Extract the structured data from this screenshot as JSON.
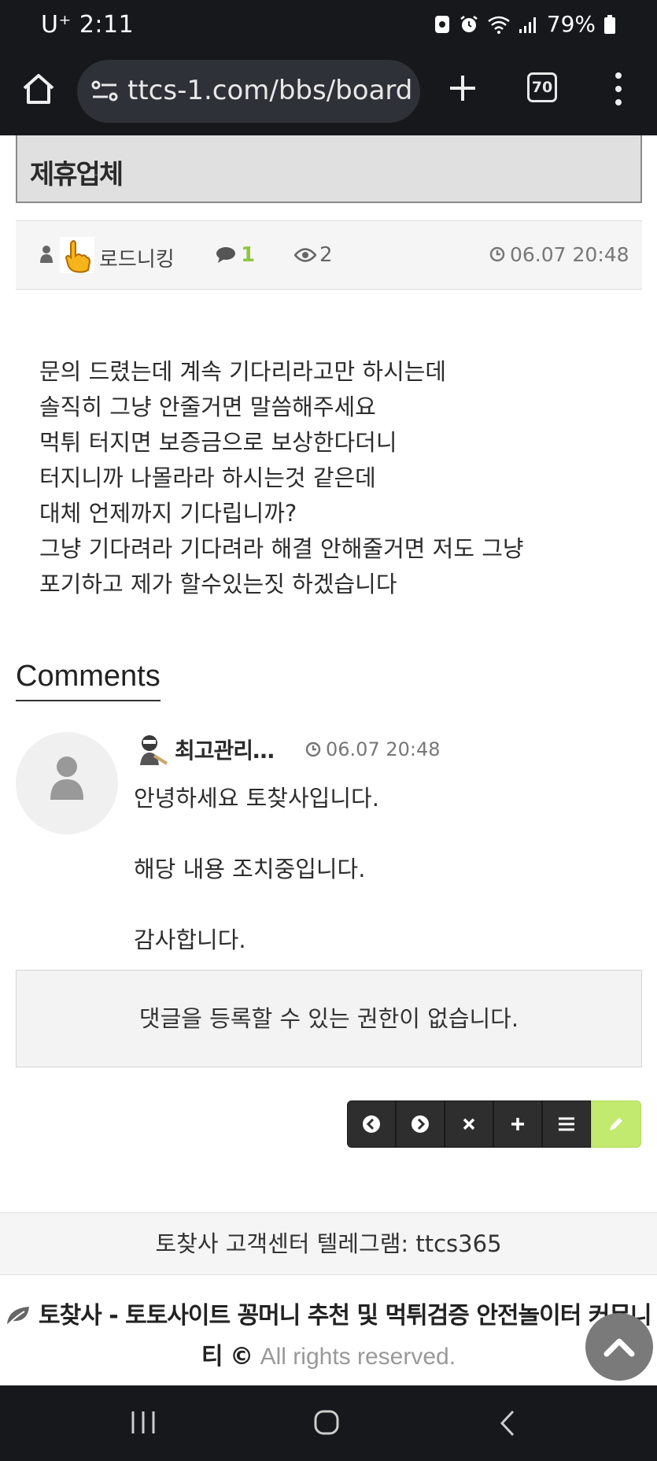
{
  "status_bar": {
    "carrier_time": "U⁺ 2:11",
    "battery": "79%"
  },
  "browser": {
    "url": "ttcs-1.com/bbs/board.",
    "tab_count": "70"
  },
  "board": {
    "title": "제휴업체"
  },
  "post": {
    "author": "로드니킹",
    "comment_count": "1",
    "views": "2",
    "date": "06.07 20:48",
    "body": [
      "문의 드렸는데 계속 기다리라고만 하시는데",
      "솔직히 그냥 안줄거면 말씀해주세요",
      "먹튀 터지면 보증금으로 보상한다더니",
      "터지니까 나몰라라 하시는것 같은데",
      "대체 언제까지 기다립니까?",
      "그냥 기다려라 기다려라 해결 안해줄거면 저도 그냥",
      "포기하고 제가 할수있는짓 하겠습니다"
    ]
  },
  "comments": {
    "heading": "Comments",
    "items": [
      {
        "author": "최고관리…",
        "date": "06.07 20:48",
        "lines": [
          "안녕하세요 토찾사입니다.",
          "해당 내용 조치중입니다.",
          "감사합니다."
        ]
      }
    ],
    "no_permission": "댓글을 등록할 수 있는 권한이 없습니다."
  },
  "toolbar": {
    "icons": [
      "chevron-left-icon",
      "chevron-right-icon",
      "close-icon",
      "plus-icon",
      "list-icon",
      "pencil-icon"
    ]
  },
  "footer": {
    "telegram": "토찾사 고객센터 텔레그램: ttcs365",
    "brand": "토찾사 - 토토사이트 꽁머니 추천 및 먹튀검증 안전놀이터 커뮤니티",
    "copyright_symbol": "©",
    "rights": "All rights reserved."
  },
  "colors": {
    "accent_green": "#8dc63f",
    "write_button": "#c2ea6e",
    "dark_bar": "#17181c"
  }
}
